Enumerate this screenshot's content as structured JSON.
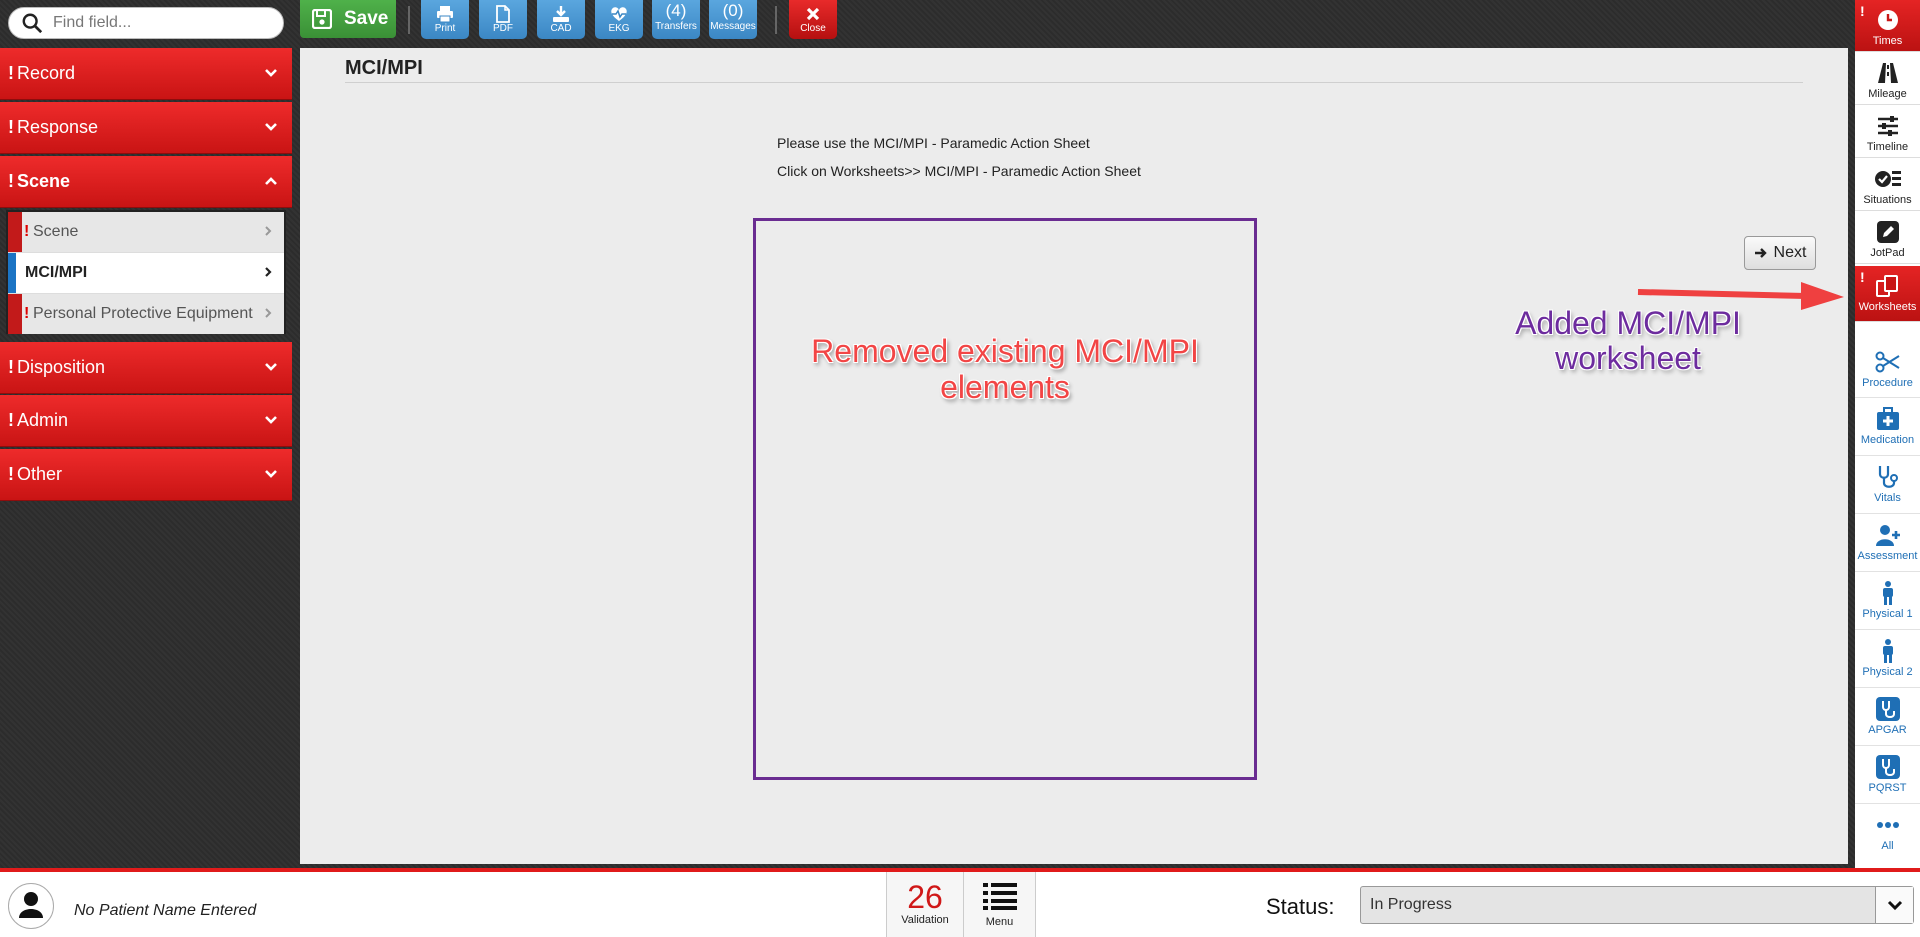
{
  "search": {
    "placeholder": "Find field..."
  },
  "sidebar": {
    "sections": [
      {
        "label": "Record",
        "alert": "!"
      },
      {
        "label": "Response",
        "alert": "!"
      },
      {
        "label": "Scene",
        "alert": "!"
      },
      {
        "label": "Disposition",
        "alert": "!"
      },
      {
        "label": "Admin",
        "alert": "!"
      },
      {
        "label": "Other",
        "alert": "!"
      }
    ],
    "subitems": [
      {
        "label": "Scene",
        "alert": "!"
      },
      {
        "label": "MCI/MPI"
      },
      {
        "label": "Personal Protective Equipment",
        "alert": "!"
      }
    ]
  },
  "toolbar": {
    "save_label": "Save",
    "print_label": "Print",
    "pdf_label": "PDF",
    "cad_label": "CAD",
    "ekg_label": "EKG",
    "transfers_count": "(4)",
    "transfers_label": "Transfers",
    "messages_count": "(0)",
    "messages_label": "Messages",
    "close_label": "Close"
  },
  "main": {
    "title": "MCI/MPI",
    "instruction_1": "Please use the MCI/MPI - Paramedic Action Sheet",
    "instruction_2": "Click on Worksheets>> MCI/MPI - Paramedic Action Sheet",
    "next_label": "Next",
    "annotation_removed": "Removed existing MCI/MPI elements",
    "annotation_added": "Added MCI/MPI worksheet"
  },
  "rightbar": {
    "items": [
      {
        "label": "Times",
        "icon": "clock-icon"
      },
      {
        "label": "Mileage",
        "icon": "road-icon"
      },
      {
        "label": "Timeline",
        "icon": "sliders-icon"
      },
      {
        "label": "Situations",
        "icon": "checklist-icon"
      },
      {
        "label": "JotPad",
        "icon": "pencil-icon"
      },
      {
        "label": "Worksheets",
        "icon": "worksheets-icon"
      },
      {
        "label": "Procedure",
        "icon": "scissors-icon"
      },
      {
        "label": "Medication",
        "icon": "medkit-icon"
      },
      {
        "label": "Vitals",
        "icon": "stethoscope-icon"
      },
      {
        "label": "Assessment",
        "icon": "user-plus-icon"
      },
      {
        "label": "Physical 1",
        "icon": "person-icon"
      },
      {
        "label": "Physical 2",
        "icon": "person-icon"
      },
      {
        "label": "APGAR",
        "icon": "stethoscope-square-icon"
      },
      {
        "label": "PQRST",
        "icon": "stethoscope-square-icon"
      },
      {
        "label": "All",
        "icon": "ellipsis-icon"
      }
    ],
    "alert": "!"
  },
  "bottombar": {
    "patient_name": "No Patient Name Entered",
    "validation_count": "26",
    "validation_label": "Validation",
    "menu_label": "Menu",
    "status_label": "Status:",
    "status_value": "In Progress"
  },
  "colors": {
    "accent_red": "#e01b1b",
    "toolbar_blue": "#3b87c4",
    "save_green": "#3a9036",
    "annotation_purple": "#6a2c91"
  }
}
